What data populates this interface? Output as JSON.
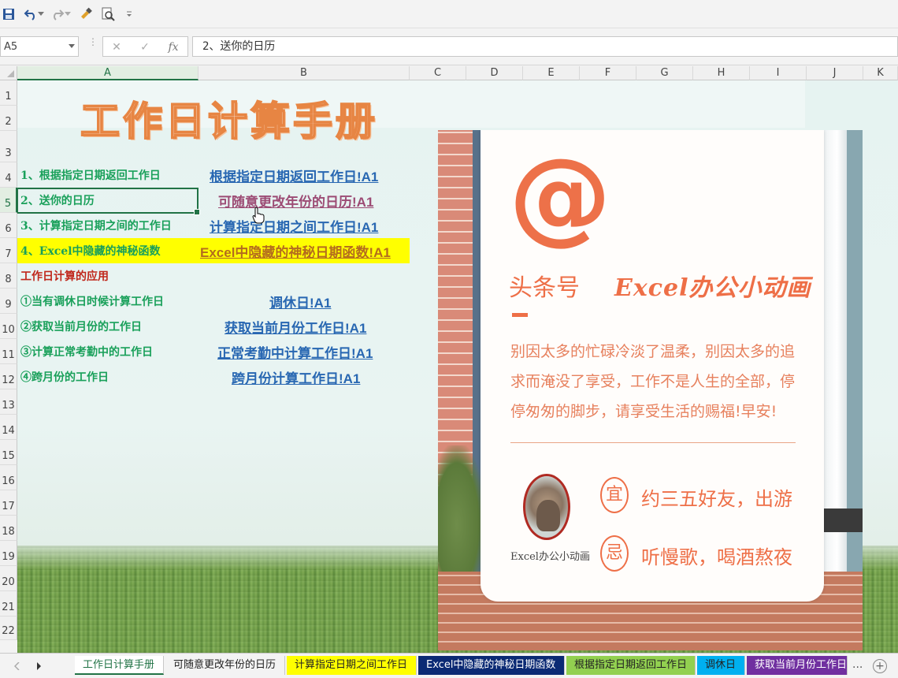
{
  "namebox": {
    "value": "A5"
  },
  "formula": {
    "value": "2、送你的日历"
  },
  "columns": [
    "A",
    "B",
    "C",
    "D",
    "E",
    "F",
    "G",
    "H",
    "I",
    "J",
    "K"
  ],
  "rows": [
    "1",
    "2",
    "3",
    "4",
    "5",
    "6",
    "7",
    "8",
    "9",
    "10",
    "11",
    "12",
    "13",
    "14",
    "15",
    "16",
    "17",
    "18",
    "19",
    "20",
    "21",
    "22"
  ],
  "sheet": {
    "title": "工作日计算手册",
    "items": [
      {
        "a": "1、根据指定日期返回工作日",
        "b": "根据指定日期返回工作日!A1"
      },
      {
        "a": "2、送你的日历",
        "b": "可随意更改年份的日历!A1"
      },
      {
        "a": "3、计算指定日期之间的工作日",
        "b": "计算指定日期之间工作日!A1"
      },
      {
        "a": "4、Excel中隐藏的神秘函数",
        "b": "Excel中隐藏的神秘日期函数!A1"
      }
    ],
    "section": "工作日计算的应用",
    "apps": [
      {
        "a": "①当有调休日时候计算工作日",
        "b": "调休日!A1"
      },
      {
        "a": "②获取当前月份的工作日",
        "b": "获取当前月份工作日!A1"
      },
      {
        "a": "③计算正常考勤中的工作日",
        "b": "正常考勤中计算工作日!A1"
      },
      {
        "a": "④跨月份的工作日",
        "b": "跨月份计算工作日!A1"
      }
    ]
  },
  "picture": {
    "at": "@",
    "toutiao": "头条号",
    "brand": "Excel办公小动画",
    "quote": "别因太多的忙碌冷淡了温柔，别因太多的追求而淹没了享受，工作不是人生的全部，停停匆匆的脚步，请享受生活的赐福!早安!",
    "avatar_caption": "Excel办公小动画",
    "yi_label": "宜",
    "yi_text": "约三五好友，出游",
    "ji_label": "忌",
    "ji_text": "听慢歌，喝酒熬夜"
  },
  "tabs": [
    {
      "label": "工作日计算手册",
      "color": "#ffffff",
      "text": "#217346"
    },
    {
      "label": "可随意更改年份的日历",
      "color": "#f3f3f3",
      "text": "#222222"
    },
    {
      "label": "计算指定日期之间工作日",
      "color": "#ffff00",
      "text": "#222222"
    },
    {
      "label": "Excel中隐藏的神秘日期函数",
      "color": "#0b2a74",
      "text": "#ffffff"
    },
    {
      "label": "根据指定日期返回工作日",
      "color": "#92d050",
      "text": "#222222"
    },
    {
      "label": "调休日",
      "color": "#00b0f0",
      "text": "#222222"
    },
    {
      "label": "获取当前月份工作日",
      "color": "#7030a0",
      "text": "#ffffff"
    }
  ],
  "tabs_more": "..."
}
